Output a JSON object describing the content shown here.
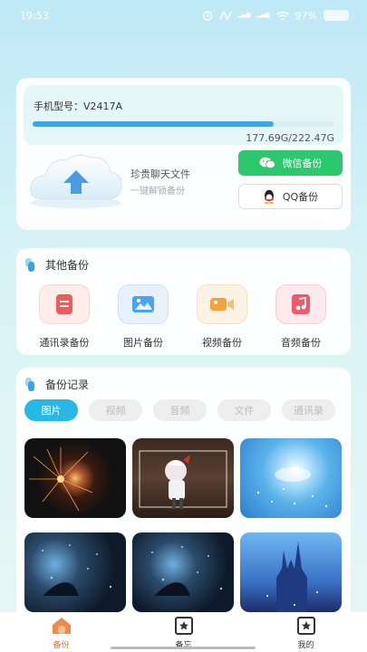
{
  "status_bar": {
    "time": "19:53",
    "battery": "97%"
  },
  "device": {
    "model_label": "手机型号：V2417A",
    "storage_text": "177.69G/222.47G",
    "storage_used_fraction": 0.799
  },
  "chat_backup": {
    "title": "珍贵聊天文件",
    "subtitle": "一键解锁备份",
    "wechat_label": "微信备份",
    "qq_label": "QQ备份"
  },
  "other_backup": {
    "title": "其他备份",
    "items": [
      {
        "label": "通讯录备份",
        "icon": "contacts-icon",
        "color": "#ef5a5a"
      },
      {
        "label": "图片备份",
        "icon": "picture-icon",
        "color": "#4aa3f0"
      },
      {
        "label": "视频备份",
        "icon": "video-icon",
        "color": "#f5a23a"
      },
      {
        "label": "音频备份",
        "icon": "music-icon",
        "color": "#ef5a6a"
      }
    ]
  },
  "records": {
    "title": "备份记录",
    "tabs": [
      "图片",
      "视频",
      "音频",
      "文件",
      "通讯录"
    ],
    "active_tab": 0
  },
  "bottom_nav": {
    "items": [
      {
        "label": "备份",
        "icon": "home-icon",
        "active": true
      },
      {
        "label": "备忘",
        "icon": "memo-icon",
        "active": false
      },
      {
        "label": "我的",
        "icon": "profile-icon",
        "active": false
      }
    ]
  },
  "colors": {
    "accent": "#27b8e6",
    "wechat": "#2cc86d",
    "active_nav": "#e0703a"
  }
}
